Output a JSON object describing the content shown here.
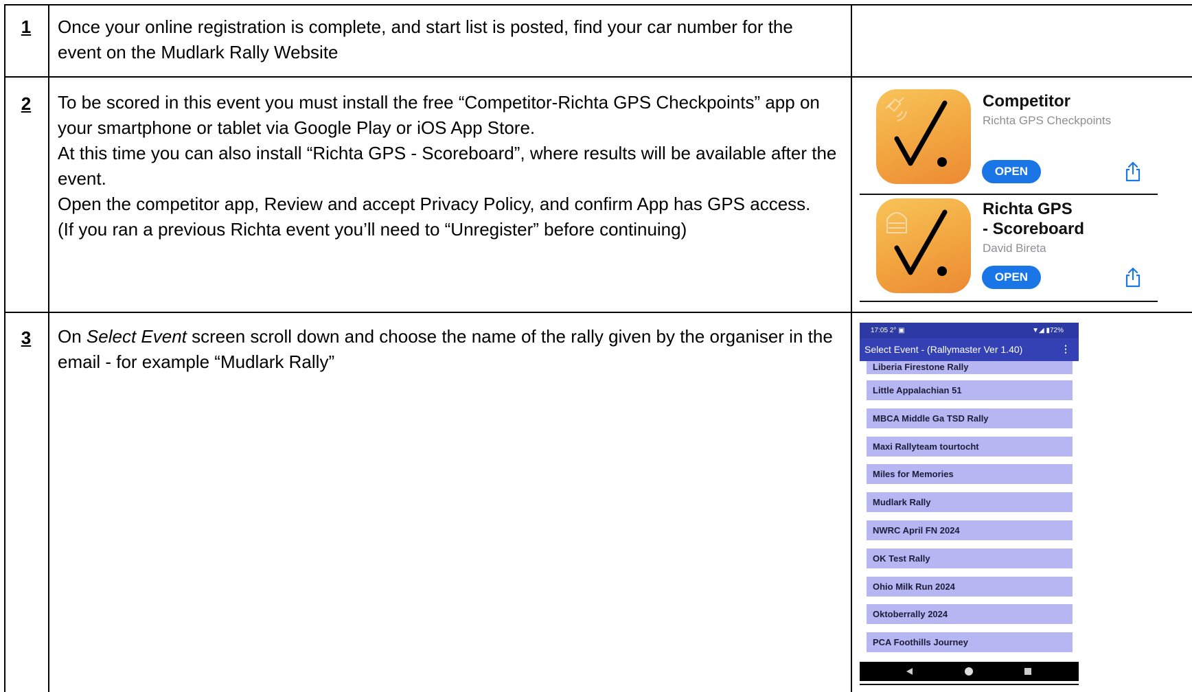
{
  "rows": [
    {
      "number": "1",
      "paragraphs": [
        "Once your online registration is complete, and start list is posted, find your car number for the event on the Mudlark Rally Website"
      ]
    },
    {
      "number": "2",
      "paragraphs": [
        "To be scored in this event you must install the free “Competitor-Richta GPS Checkpoints” app on your smartphone or tablet via Google Play or iOS App Store.",
        "At this time you can also install “Richta GPS - Scoreboard”, where results will be available after the event.",
        "Open the competitor app, Review and accept Privacy Policy, and confirm App has GPS access.",
        "(If you ran a previous Richta event you’ll need to “Unregister” before continuing)"
      ]
    },
    {
      "number": "3",
      "text_before": "On ",
      "text_italic": "Select Event",
      "text_after": " screen scroll down and choose the name of the rally given by the organiser in the email - for example “Mudlark Rally”"
    }
  ],
  "apps": [
    {
      "name": "Competitor",
      "subtitle": "Richta GPS Checkpoints",
      "button": "OPEN",
      "icon": "satellite-checkmark-icon"
    },
    {
      "name_line1": "Richta GPS",
      "name_line2": "- Scoreboard",
      "subtitle": "David Bireta",
      "button": "OPEN",
      "icon": "scoreboard-checkmark-icon"
    }
  ],
  "phone": {
    "time": "17:05",
    "status_left_extra": "2° ▣",
    "battery": "72%",
    "appbar_title": "Select Event - (Rallymaster Ver 1.40)",
    "menu_icon": "⋮",
    "events": [
      "Liberia Firestone Rally",
      "Little Appalachian 51",
      "MBCA Middle Ga TSD Rally",
      "Maxi Rallyteam tourtocht",
      "Miles for Memories",
      "Mudlark Rally",
      "NWRC April FN 2024",
      "OK Test Rally",
      "Ohio Milk Run 2024",
      "Oktoberrally 2024",
      "PCA Foothills Journey"
    ]
  },
  "colors": {
    "phone_status_bar": "#2d3aa4",
    "phone_app_bar": "#3341b5",
    "event_item": "#b6b7f2",
    "open_button": "#1a76e6",
    "app_icon_gradient": "#f8c45a"
  }
}
